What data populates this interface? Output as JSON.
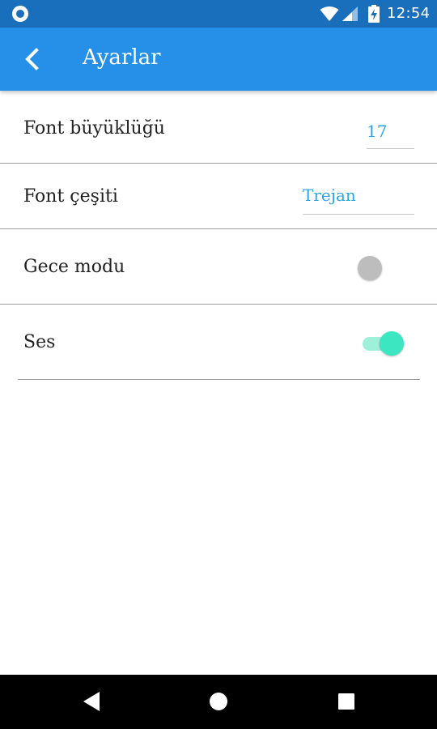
{
  "status_bar": {
    "time": "12:54",
    "icons": [
      "notification-icon",
      "wifi-icon",
      "signal-icon",
      "battery-charging-icon"
    ]
  },
  "app_bar": {
    "title": "Ayarlar",
    "back_icon": "chevron-left-icon",
    "background_color": "#2690e8"
  },
  "settings": {
    "font_size": {
      "label": "Font büyüklüğü",
      "value": "17"
    },
    "font_type": {
      "label": "Font çeşiti",
      "value": "Trejan"
    },
    "night_mode": {
      "label": "Gece modu",
      "enabled": false
    },
    "sound": {
      "label": "Ses",
      "enabled": true
    }
  },
  "nav_bar": {
    "icons": [
      "back-triangle-icon",
      "home-circle-icon",
      "recents-square-icon"
    ]
  },
  "colors": {
    "status_bar": "#1a6fbd",
    "accent_text": "#29a6e6",
    "toggle_on": "#3ce6c0"
  }
}
